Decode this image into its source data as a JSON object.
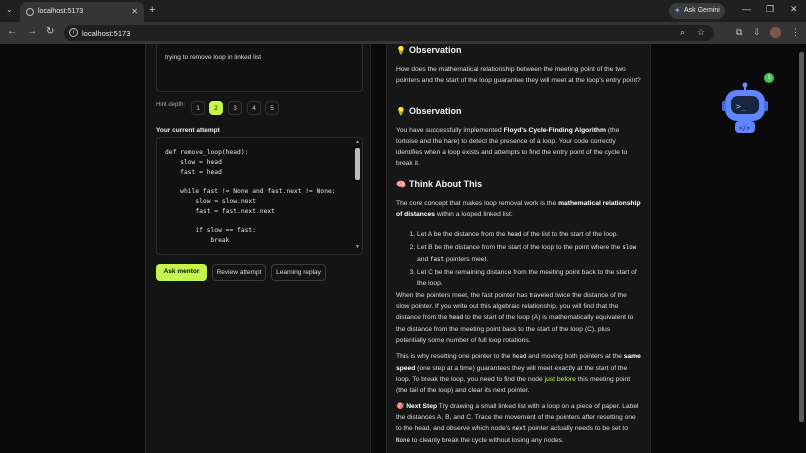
{
  "browser": {
    "tab_title": "localhost:5173",
    "url": "localhost:5173",
    "gemini_label": "Ask Gemini"
  },
  "left": {
    "prompt_text": "trying to remove  loop in linked list",
    "hint_label": "Hint depth:",
    "depths": [
      "1",
      "2",
      "3",
      "4",
      "5"
    ],
    "active_depth": "2",
    "attempt_label": "Your current attempt",
    "code": "def remove_loop(head):\n    slow = head\n    fast = head\n\n    while fast != None and fast.next != None:\n        slow = slow.next\n        fast = fast.next.next\n\n        if slow == fast:\n            break",
    "buttons": {
      "ask": "Ask mentor",
      "review": "Review attempt",
      "replay": "Learning replay"
    }
  },
  "right": {
    "obs1_title": "Observation",
    "obs1_text": "How does the mathematical relationship between the meeting point of the two pointers and the start of the loop guarantee they will meet at the loop's entry point?",
    "obs2_title": "Observation",
    "obs2_text_a": "You have successfully implemented ",
    "obs2_bold": "Floyd's Cycle-Finding Algorithm",
    "obs2_text_b": " (the tortoise and the hare) to detect the presence of a loop. Your code correctly identifies when a loop exists and attempts to find the entry point of the cycle to break it.",
    "think_title": "Think About This",
    "think_text_a": "The core concept that makes loop removal work is the ",
    "think_bold": "mathematical relationship of distances",
    "think_text_b": " within a looped linked list:",
    "list1_a": "Let A be the distance from the ",
    "list1_code": "head",
    "list1_b": " of the list to the start of the loop.",
    "list2_a": "Let B be the distance from the start of the loop to the point where the ",
    "list2_code1": "slow",
    "list2_and": " and ",
    "list2_code2": "fast",
    "list2_b": " pointers meet.",
    "list3": "Let C be the remaining distance from the meeting point back to the start of the loop.",
    "para1_a": "When the pointers meet, the fast pointer has traveled twice the distance of the slow pointer. If you write out this algebraic relationship, you will find that the distance from the ",
    "para1_code": "head",
    "para1_b": " to the start of the loop (A) is mathematically equivalent to the distance from the meeting point back to the start of the loop (C), plus potentially some number of full loop rotations.",
    "para2_a": "This is why resetting one pointer to the ",
    "para2_code": "head",
    "para2_b": " and moving both pointers at the ",
    "para2_bold": "same speed",
    "para2_c": " (one step at a time) guarantees they will meet exactly at the start of the loop. To break the loop, you need to find the node ",
    "para2_link": "just before",
    "para2_d": " this meeting point (the tail of the loop) and clear its next pointer.",
    "next_bold": "Next Step",
    "next_a": " Try drawing a small linked list with a loop on a piece of paper. Label the distances A, B, and C. Trace the movement of the pointers after resetting one to the head, and observe which node's ",
    "next_code1": "next",
    "next_b": " pointer actually needs to be set to ",
    "next_code2": "None",
    "next_c": " to cleanly break the cycle without losing any nodes."
  },
  "mascot": {
    "badge": "1"
  },
  "colors": {
    "accent": "#c5f54a",
    "panel": "#141414"
  }
}
